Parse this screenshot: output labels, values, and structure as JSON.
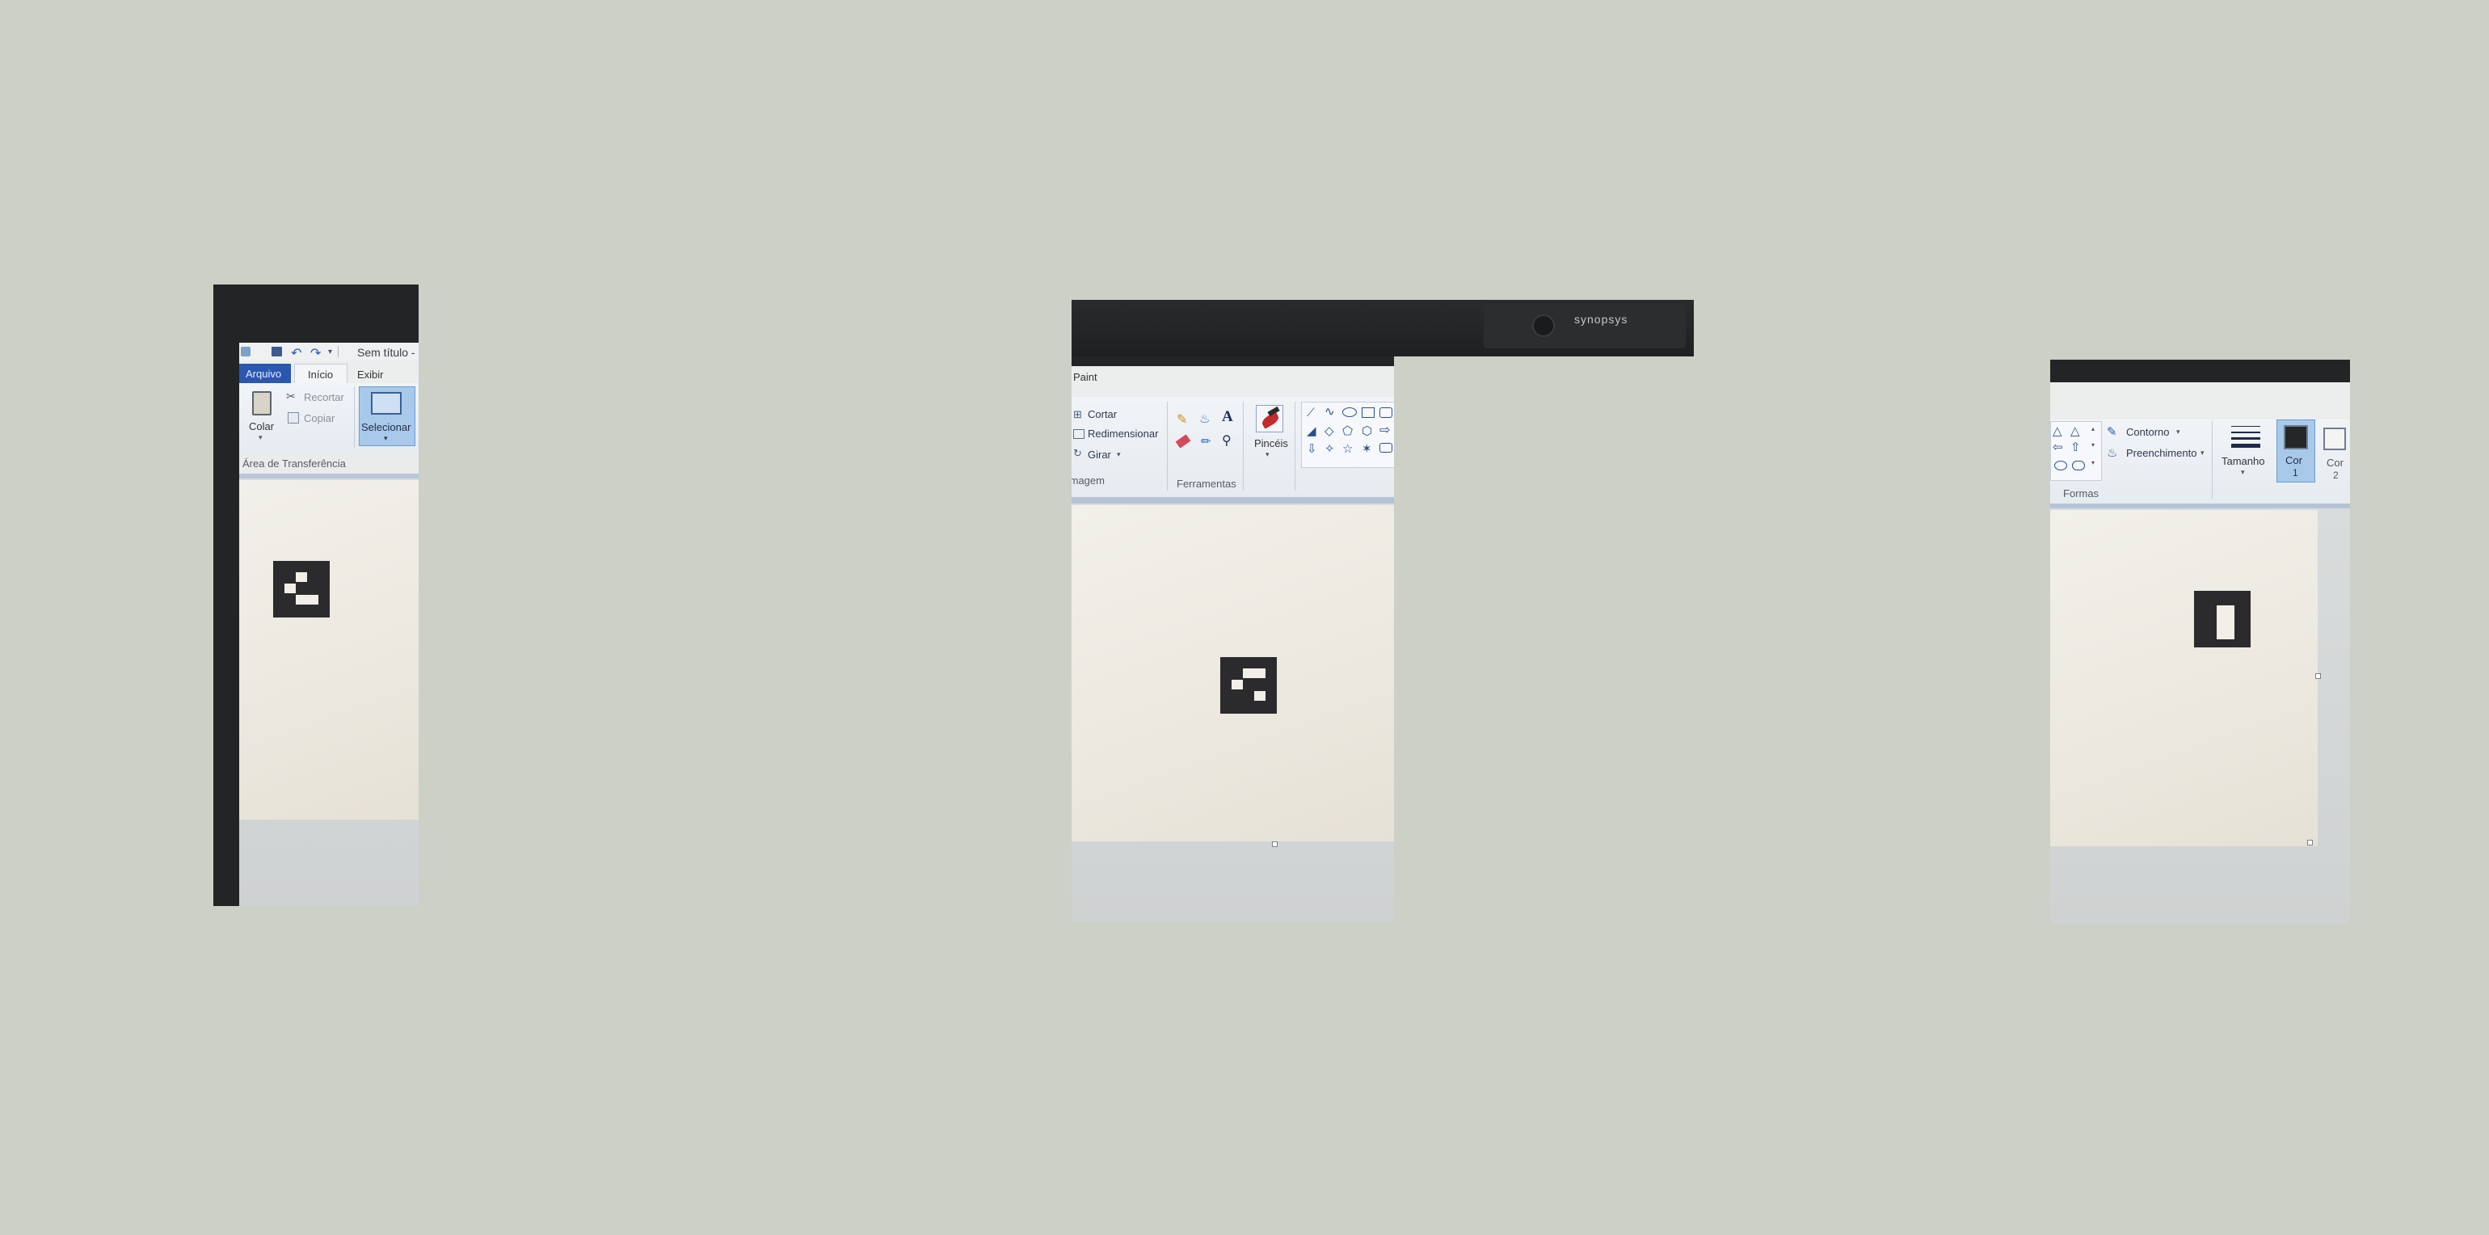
{
  "left_photo": {
    "title": "Sem título -",
    "tabs": {
      "file": "Arquivo",
      "home": "Início",
      "view": "Exibir"
    },
    "clipboard": {
      "paste": "Colar",
      "cut": "Recortar",
      "copy": "Copiar",
      "group_label": "Área de Transferência"
    },
    "select_label": "Selecionar"
  },
  "center_photo": {
    "title": "Paint",
    "monitor_brand": "SYNOPSYS",
    "image_group": {
      "crop": "Cortar",
      "resize": "Redimensionar",
      "rotate": "Girar",
      "group_label": "Imagem"
    },
    "tools_label": "Ferramentas",
    "brushes_label": "Pincéis"
  },
  "right_photo": {
    "outline": "Contorno",
    "fill": "Preenchimento",
    "size": "Tamanho",
    "color1_a": "Cor",
    "color1_b": "1",
    "color2_a": "Cor",
    "color2_b": "2",
    "shapes_label": "Formas"
  },
  "colors": {
    "background": "#cdd0c6",
    "monitor_bezel": "#242526",
    "file_tab": "#2b57b0",
    "selected_tool": "#a9c9ea",
    "marker": "#2b2b2e"
  }
}
